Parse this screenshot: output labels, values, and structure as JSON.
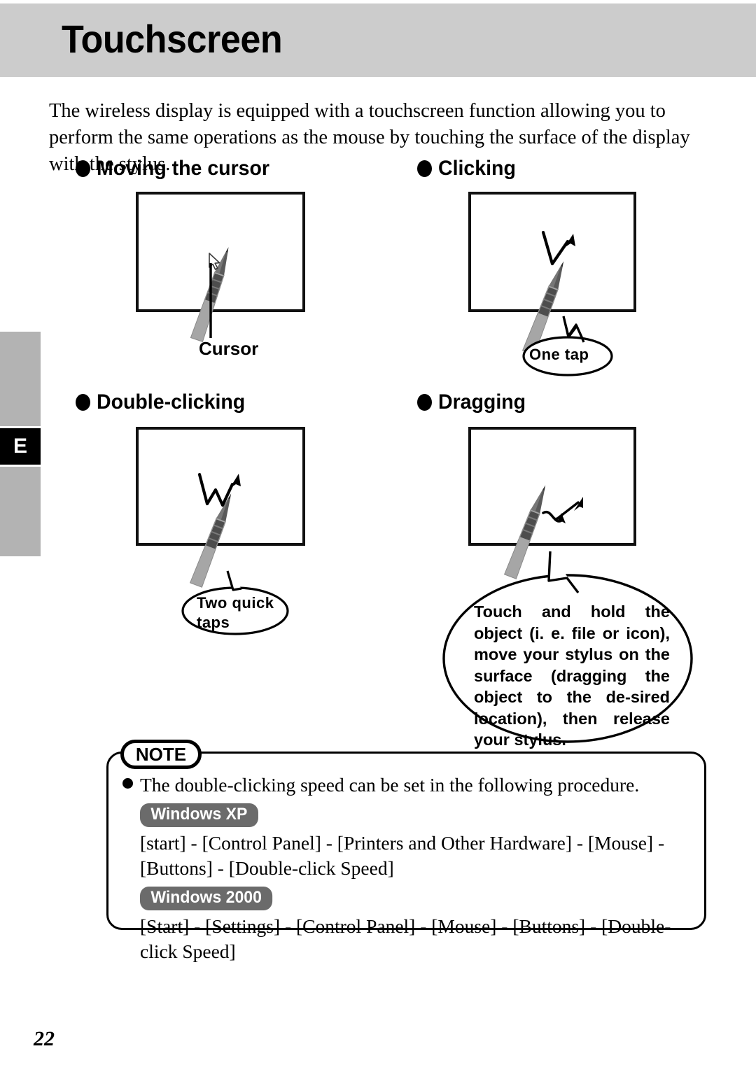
{
  "page": {
    "title": "Touchscreen",
    "number": "22",
    "side_tab_letter": "E"
  },
  "intro": "The wireless display is equipped with a touchscreen function allowing you to perform the same operations as the mouse by touching the surface of the display with the stylus.",
  "sections": [
    {
      "id": "moving",
      "heading": "Moving the cursor",
      "caption": "Cursor"
    },
    {
      "id": "clicking",
      "heading": "Clicking",
      "balloon": "One tap"
    },
    {
      "id": "double",
      "heading": "Double-clicking",
      "balloon": "Two quick taps"
    },
    {
      "id": "dragging",
      "heading": "Dragging",
      "balloon": "Touch and hold the object (i. e. file or icon), move your stylus on the surface (dragging the object to the de-sired location), then release your stylus."
    }
  ],
  "note": {
    "tag": "NOTE",
    "bullet_text": "The double-clicking speed can be set in the following procedure.",
    "os_entries": [
      {
        "badge": "Windows XP",
        "path": "[start] - [Control Panel] - [Printers and Other Hardware] - [Mouse] - [Buttons] - [Double-click Speed]"
      },
      {
        "badge": "Windows 2000",
        "path": "[Start] - [Settings] - [Control Panel] - [Mouse] - [Buttons] - [Double-click Speed]"
      }
    ]
  },
  "colors": {
    "header_band": "#cccccc",
    "side_tab_gray": "#b3b3b3",
    "side_tab_black": "#000000",
    "badge_gray": "#6b6b6b",
    "stylus_body": "#a6a6a6",
    "stylus_grip": "#4d4d4d"
  }
}
